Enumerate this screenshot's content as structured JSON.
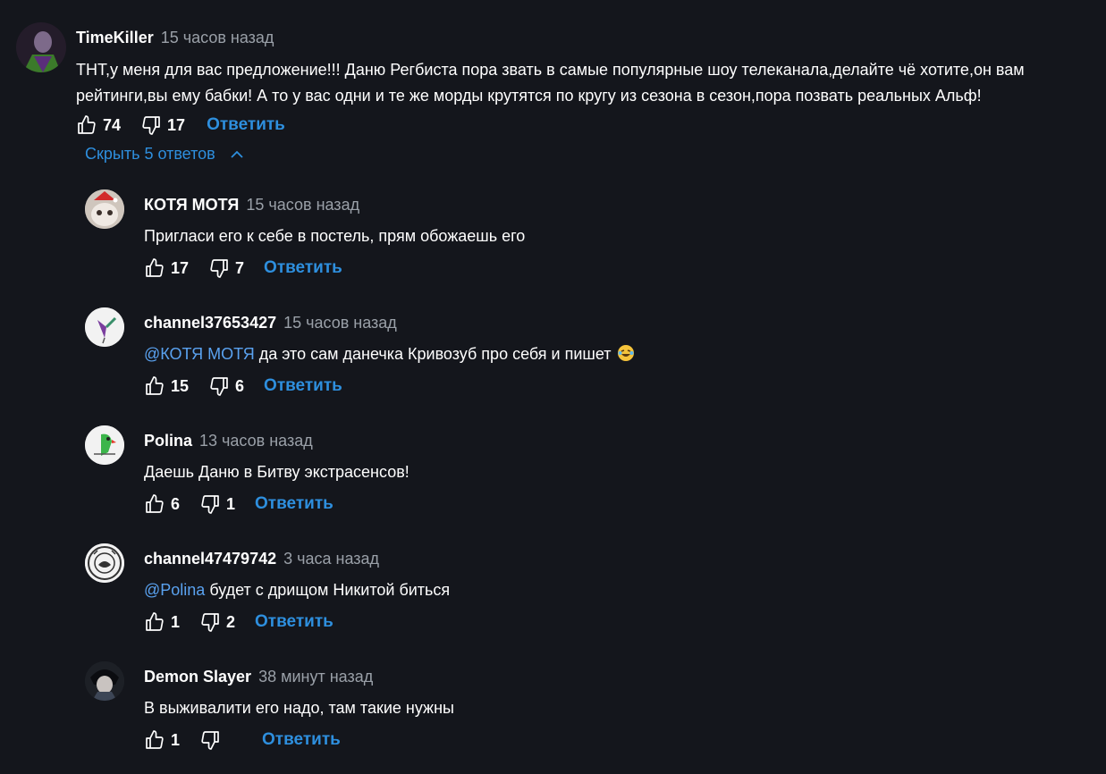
{
  "toggle_replies": "Скрыть 5 ответов",
  "reply_label": "Ответить",
  "main_comment": {
    "author": "TimeKiller",
    "time": "15 часов назад",
    "text_line1": "ТНТ,у меня для вас предложение!!! Даню Регбиста пора звать в самые популярные шоу телеканала,делайте чё хотите,он вам",
    "text_line2": "рейтинги,вы ему бабки! А то у вас одни и те же морды крутятся по кругу из сезона в сезон,пора позвать реальных Альф!",
    "likes": "74",
    "dislikes": "17"
  },
  "replies": [
    {
      "author": "КОТЯ МОТЯ",
      "time": "15 часов назад",
      "mention": "",
      "text": "Пригласи его к себе в постель, прям обожаешь его",
      "likes": "17",
      "dislikes": "7"
    },
    {
      "author": "channel37653427",
      "time": "15 часов назад",
      "mention": "@КОТЯ МОТЯ",
      "text": " да это сам данечка Кривозуб про себя и пишет",
      "likes": "15",
      "dislikes": "6"
    },
    {
      "author": "Polina",
      "time": "13 часов назад",
      "mention": "",
      "text": "Даешь Даню в Битву экстрасенсов!",
      "likes": "6",
      "dislikes": "1"
    },
    {
      "author": "channel47479742",
      "time": "3 часа назад",
      "mention": "@Polina",
      "text": " будет с дрищом Никитой биться",
      "likes": "1",
      "dislikes": "2"
    },
    {
      "author": "Demon Slayer",
      "time": "38 минут назад",
      "mention": "",
      "text": "В выживалити его надо, там такие нужны",
      "likes": "1",
      "dislikes": ""
    }
  ]
}
